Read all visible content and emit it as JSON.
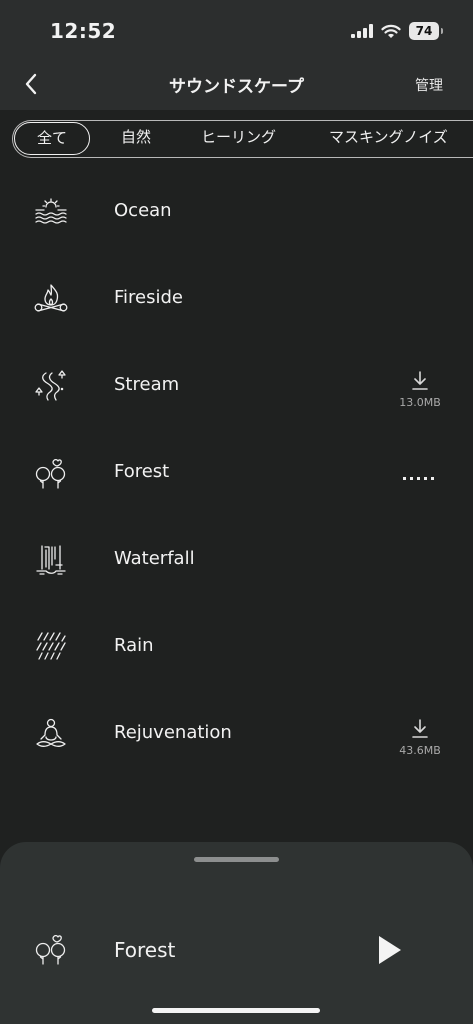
{
  "status": {
    "time": "12:52",
    "battery": "74"
  },
  "nav": {
    "title": "サウンドスケープ",
    "manage": "管理"
  },
  "tabs": [
    {
      "label": "全て",
      "active": true
    },
    {
      "label": "自然"
    },
    {
      "label": "ヒーリング"
    },
    {
      "label": "マスキングノイズ"
    }
  ],
  "sounds": [
    {
      "label": "Ocean",
      "icon": "ocean-icon"
    },
    {
      "label": "Fireside",
      "icon": "fireside-icon"
    },
    {
      "label": "Stream",
      "icon": "stream-icon",
      "download_size": "13.0MB"
    },
    {
      "label": "Forest",
      "icon": "forest-icon",
      "status": "downloading-dots"
    },
    {
      "label": "Waterfall",
      "icon": "waterfall-icon"
    },
    {
      "label": "Rain",
      "icon": "rain-icon"
    },
    {
      "label": "Rejuvenation",
      "icon": "rejuvenation-icon",
      "download_size": "43.6MB"
    }
  ],
  "now_playing": {
    "label": "Forest",
    "icon": "forest-icon",
    "control": "play-icon"
  },
  "colors": {
    "background": "#1f2120",
    "header": "#2c2e2e",
    "sheet": "#2f3332",
    "text": "#f2f2f2",
    "muted": "#a9a9a9"
  }
}
